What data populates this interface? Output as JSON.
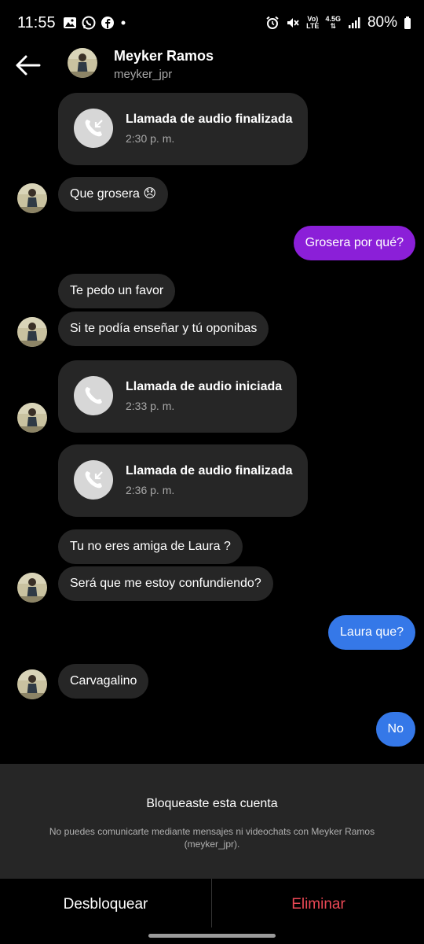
{
  "status_bar": {
    "time": "11:55",
    "net_top": "Vo)",
    "net_bottom": "LTE",
    "net_gen": "4.5G",
    "battery": "80%"
  },
  "header": {
    "name": "Meyker Ramos",
    "username": "meyker_jpr"
  },
  "messages": [
    {
      "type": "call",
      "title": "Llamada de audio finalizada",
      "time": "2:30 p. m."
    },
    {
      "type": "in",
      "text": "Que grosera 😞"
    },
    {
      "type": "out",
      "text": "Grosera por qué?"
    },
    {
      "type": "in",
      "text": "Te pedo un favor"
    },
    {
      "type": "in",
      "text": "Si te podía enseñar y tú oponibas"
    },
    {
      "type": "call",
      "title": "Llamada de audio iniciada",
      "time": "2:33 p. m."
    },
    {
      "type": "call",
      "title": "Llamada de audio finalizada",
      "time": "2:36 p. m."
    },
    {
      "type": "in",
      "text": "Tu no eres amiga de Laura ?"
    },
    {
      "type": "in",
      "text": "Será que me estoy confundiendo?"
    },
    {
      "type": "out",
      "text": "Laura que?"
    },
    {
      "type": "in",
      "text": "Carvagalino"
    },
    {
      "type": "out",
      "text": "No"
    }
  ],
  "blocked": {
    "title": "Bloqueaste esta cuenta",
    "description": "No puedes comunicarte mediante mensajes ni videochats con Meyker Ramos (meyker_jpr)."
  },
  "actions": {
    "unblock": "Desbloquear",
    "delete": "Eliminar"
  },
  "colors": {
    "purple_bubble": "#8b1fd8",
    "blue_bubble": "#3578e8",
    "incoming_bubble": "#262626",
    "delete_red": "#ed4956"
  }
}
